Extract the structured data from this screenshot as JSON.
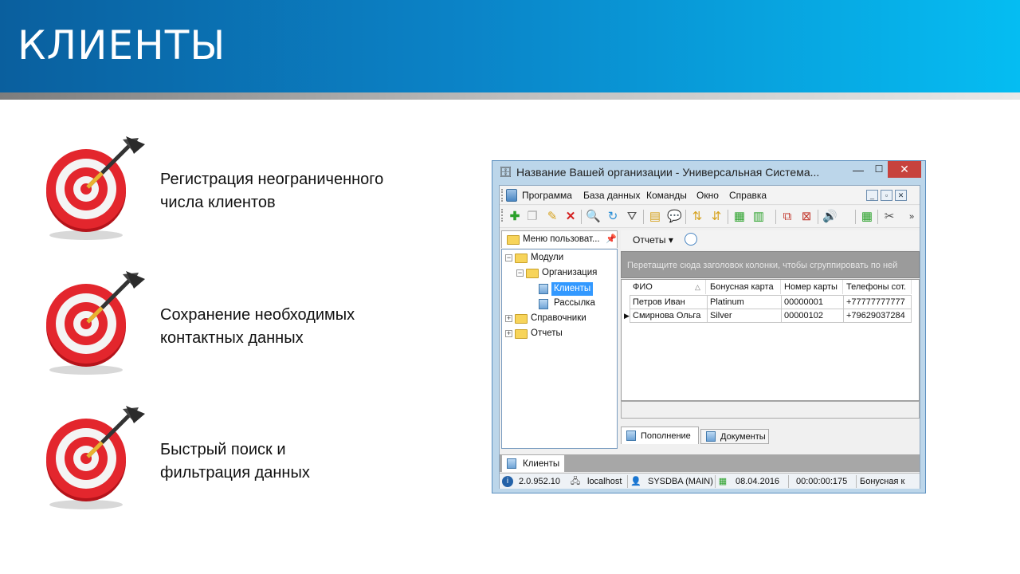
{
  "slide": {
    "title": "КЛИЕНТЫ",
    "features": [
      {
        "line1": "Регистрация неограниченного",
        "line2": "числа клиентов"
      },
      {
        "line1": "Сохранение необходимых",
        "line2": "контактных данных"
      },
      {
        "line1": "Быстрый поиск и",
        "line2": "фильтрация данных"
      }
    ]
  },
  "window": {
    "title": "Название Вашей организации - Универсальная Система...",
    "controls": {
      "minimize": "—",
      "maximize": "☐",
      "close": "✕"
    },
    "menu": [
      "Программа",
      "База данных",
      "Команды",
      "Окно",
      "Справка"
    ],
    "mdi_controls": {
      "minimize": "_",
      "restore": "▫",
      "close": "✕"
    },
    "toolbar_icons": [
      "add-icon",
      "copy-icon",
      "edit-icon",
      "delete-icon",
      "search-icon",
      "refresh-icon",
      "filter-icon",
      "import-icon",
      "comment-icon",
      "sort-asc-icon",
      "sort-desc-icon",
      "export-excel-icon",
      "export-icon",
      "new-window-icon",
      "close-window-icon",
      "sound-icon",
      "calendar-icon",
      "tools-icon"
    ],
    "left_panel": {
      "title": "Меню пользоват...",
      "tree": [
        {
          "label": "Модули",
          "level": 0,
          "expander": "−"
        },
        {
          "label": "Организация",
          "level": 1,
          "expander": "−"
        },
        {
          "label": "Клиенты",
          "level": 2,
          "selected": true
        },
        {
          "label": "Рассылка",
          "level": 2
        },
        {
          "label": "Справочники",
          "level": 0,
          "expander": "+"
        },
        {
          "label": "Отчеты",
          "level": 0,
          "expander": "+"
        }
      ]
    },
    "right_panel": {
      "reports_menu": "Отчеты ▾",
      "group_hint": "Перетащите сюда заголовок колонки, чтобы сгруппировать по ней",
      "columns": [
        "ФИО",
        "Бонусная карта",
        "Номер карты",
        "Телефоны сот."
      ],
      "rows": [
        [
          "Петров Иван",
          "Platinum",
          "00000001",
          "+77777777777"
        ],
        [
          "Смирнова Ольга",
          "Silver",
          "00000102",
          "+79629037284"
        ]
      ],
      "current_row_marker": "▶",
      "tabs": [
        "Пополнение",
        "Документы"
      ]
    },
    "task_tab": "Клиенты",
    "status": {
      "version": "2.0.952.10",
      "host": "localhost",
      "user": "SYSDBA (MAIN)",
      "date": "08.04.2016",
      "timer": "00:00:00:175",
      "extra": "Бонусная к"
    }
  }
}
